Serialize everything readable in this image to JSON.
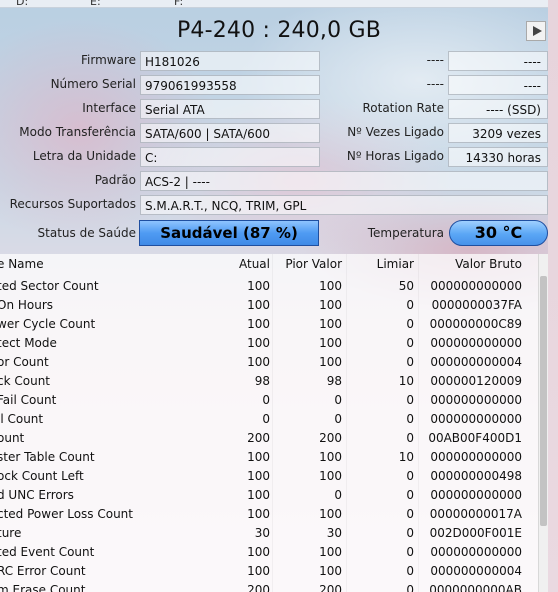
{
  "drive_tabs": [
    "D:",
    "E:",
    "F:"
  ],
  "title": "P4-240 : 240,0 GB",
  "fields": {
    "firmware": {
      "label": "Firmware",
      "value": "H181026"
    },
    "serial": {
      "label": "Número Serial",
      "value": "979061993558"
    },
    "interface": {
      "label": "Interface",
      "value": "Serial ATA"
    },
    "transfer": {
      "label": "Modo Transferência",
      "value": "SATA/600 | SATA/600"
    },
    "letter": {
      "label": "Letra da Unidade",
      "value": "C:"
    },
    "standard": {
      "label": "Padrão",
      "value": "ACS-2 | ----"
    },
    "features": {
      "label": "Recursos Suportados",
      "value": "S.M.A.R.T., NCQ, TRIM, GPL"
    }
  },
  "right_fields": {
    "blank1_label": "----",
    "blank1_value": "----",
    "blank2_label": "----",
    "blank2_value": "----",
    "rotation": {
      "label": "Rotation Rate",
      "value": "---- (SSD)"
    },
    "power_on_count": {
      "label": "Nº Vezes Ligado",
      "value": "3209 vezes"
    },
    "power_on_hours": {
      "label": "Nº Horas Ligado",
      "value": "14330 horas"
    }
  },
  "health": {
    "label": "Status de Saúde",
    "value": "Saudável  (87 %)"
  },
  "temperature": {
    "label": "Temperatura",
    "value": "30 °C"
  },
  "table": {
    "headers": {
      "name": "e Name",
      "atual": "Atual",
      "pior": "Pior Valor",
      "limiar": "Limiar",
      "raw": "Valor Bruto"
    },
    "rows": [
      {
        "name": "ted Sector Count",
        "atual": "100",
        "pior": "100",
        "limiar": "50",
        "raw": "000000000000"
      },
      {
        "name": "On Hours",
        "atual": "100",
        "pior": "100",
        "limiar": "0",
        "raw": "0000000037FA"
      },
      {
        "name": "wer Cycle Count",
        "atual": "100",
        "pior": "100",
        "limiar": "0",
        "raw": "000000000C89"
      },
      {
        "name": "tect Mode",
        "atual": "100",
        "pior": "100",
        "limiar": "0",
        "raw": "000000000000"
      },
      {
        "name": "or Count",
        "atual": "100",
        "pior": "100",
        "limiar": "0",
        "raw": "000000000004"
      },
      {
        "name": "ck Count",
        "atual": "98",
        "pior": "98",
        "limiar": "10",
        "raw": "000000120009"
      },
      {
        "name": "Fail Count",
        "atual": "0",
        "pior": "0",
        "limiar": "0",
        "raw": "000000000000"
      },
      {
        "name": "il Count",
        "atual": "0",
        "pior": "0",
        "limiar": "0",
        "raw": "000000000000"
      },
      {
        "name": "ount",
        "atual": "200",
        "pior": "200",
        "limiar": "0",
        "raw": "00AB00F400D1"
      },
      {
        "name": "ster Table Count",
        "atual": "100",
        "pior": "100",
        "limiar": "10",
        "raw": "000000000000"
      },
      {
        "name": "ock Count Left",
        "atual": "100",
        "pior": "100",
        "limiar": "0",
        "raw": "000000000498"
      },
      {
        "name": "d UNC Errors",
        "atual": "100",
        "pior": "0",
        "limiar": "0",
        "raw": "000000000000"
      },
      {
        "name": "cted Power Loss Count",
        "atual": "100",
        "pior": "100",
        "limiar": "0",
        "raw": "00000000017A"
      },
      {
        "name": "ture",
        "atual": "30",
        "pior": "30",
        "limiar": "0",
        "raw": "002D000F001E"
      },
      {
        "name": "ted Event Count",
        "atual": "100",
        "pior": "100",
        "limiar": "0",
        "raw": "000000000000"
      },
      {
        "name": "RC Error Count",
        "atual": "100",
        "pior": "100",
        "limiar": "0",
        "raw": "000000000004"
      },
      {
        "name": "m Erase Count",
        "atual": "200",
        "pior": "200",
        "limiar": "0",
        "raw": "0000000000AB"
      }
    ]
  }
}
